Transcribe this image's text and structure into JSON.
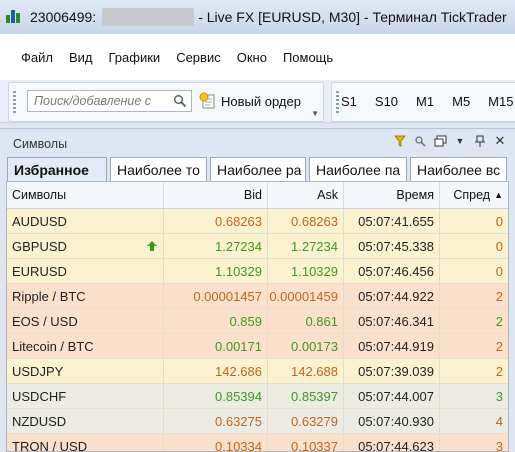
{
  "title": {
    "account": "23006499:",
    "text": "- Live FX [EURUSD, M30] - Терминал TickTrader"
  },
  "menu": [
    "Файл",
    "Вид",
    "Графики",
    "Сервис",
    "Окно",
    "Помощь"
  ],
  "toolbar": {
    "search_placeholder": "Поиск/добавление с",
    "new_order_label": "Новый ордер",
    "timeframes": [
      "S1",
      "S10",
      "M1",
      "M5",
      "M15"
    ]
  },
  "symbols_panel": {
    "title": "Символы",
    "tabs": [
      "Избранное",
      "Наиболее то",
      "Наиболее ра",
      "Наиболее па",
      "Наиболее вс"
    ],
    "columns": {
      "symbol": "Символы",
      "bid": "Bid",
      "ask": "Ask",
      "time": "Время",
      "spread": "Спред"
    },
    "rows": [
      {
        "symbol": "AUDUSD",
        "bid": "0.68263",
        "ask": "0.68263",
        "time": "05:07:41.655",
        "spread": "0",
        "bg": "#fbf3cf",
        "bid_color": "#c0661a",
        "ask_color": "#c0661a",
        "spread_color": "#c0661a",
        "arrow": false
      },
      {
        "symbol": "GBPUSD",
        "bid": "1.27234",
        "ask": "1.27234",
        "time": "05:07:45.338",
        "spread": "0",
        "bg": "#fbf3cf",
        "bid_color": "#3c9a1f",
        "ask_color": "#3c9a1f",
        "spread_color": "#c0661a",
        "arrow": true
      },
      {
        "symbol": "EURUSD",
        "bid": "1.10329",
        "ask": "1.10329",
        "time": "05:07:46.456",
        "spread": "0",
        "bg": "#fbf3cf",
        "bid_color": "#3c9a1f",
        "ask_color": "#3c9a1f",
        "spread_color": "#c0661a",
        "arrow": false
      },
      {
        "symbol": "Ripple / BTC",
        "bid": "0.00001457",
        "ask": "0.00001459",
        "time": "05:07:44.922",
        "spread": "2",
        "bg": "#fbe0cb",
        "bid_color": "#c0661a",
        "ask_color": "#c0661a",
        "spread_color": "#c0661a",
        "arrow": false
      },
      {
        "symbol": "EOS / USD",
        "bid": "0.859",
        "ask": "0.861",
        "time": "05:07:46.341",
        "spread": "2",
        "bg": "#fbe0cb",
        "bid_color": "#3c9a1f",
        "ask_color": "#3c9a1f",
        "spread_color": "#3c9a1f",
        "arrow": false
      },
      {
        "symbol": "Litecoin / BTC",
        "bid": "0.00171",
        "ask": "0.00173",
        "time": "05:07:44.919",
        "spread": "2",
        "bg": "#fbe0cb",
        "bid_color": "#3c9a1f",
        "ask_color": "#3c9a1f",
        "spread_color": "#c0661a",
        "arrow": false
      },
      {
        "symbol": "USDJPY",
        "bid": "142.686",
        "ask": "142.688",
        "time": "05:07:39.039",
        "spread": "2",
        "bg": "#fbf3cf",
        "bid_color": "#c0661a",
        "ask_color": "#c0661a",
        "spread_color": "#c0661a",
        "arrow": false
      },
      {
        "symbol": "USDCHF",
        "bid": "0.85394",
        "ask": "0.85397",
        "time": "05:07:44.007",
        "spread": "3",
        "bg": "#ecece5",
        "bid_color": "#3c9a1f",
        "ask_color": "#3c9a1f",
        "spread_color": "#3c9a1f",
        "arrow": false
      },
      {
        "symbol": "NZDUSD",
        "bid": "0.63275",
        "ask": "0.63279",
        "time": "05:07:40.930",
        "spread": "4",
        "bg": "#ecece5",
        "bid_color": "#c0661a",
        "ask_color": "#c0661a",
        "spread_color": "#c0661a",
        "arrow": false
      },
      {
        "symbol": "TRON / USD",
        "bid": "0.10334",
        "ask": "0.10337",
        "time": "05:07:44.623",
        "spread": "3",
        "bg": "#fbe0cb",
        "bid_color": "#c0661a",
        "ask_color": "#c0661a",
        "spread_color": "#c0661a",
        "arrow": false
      }
    ]
  }
}
